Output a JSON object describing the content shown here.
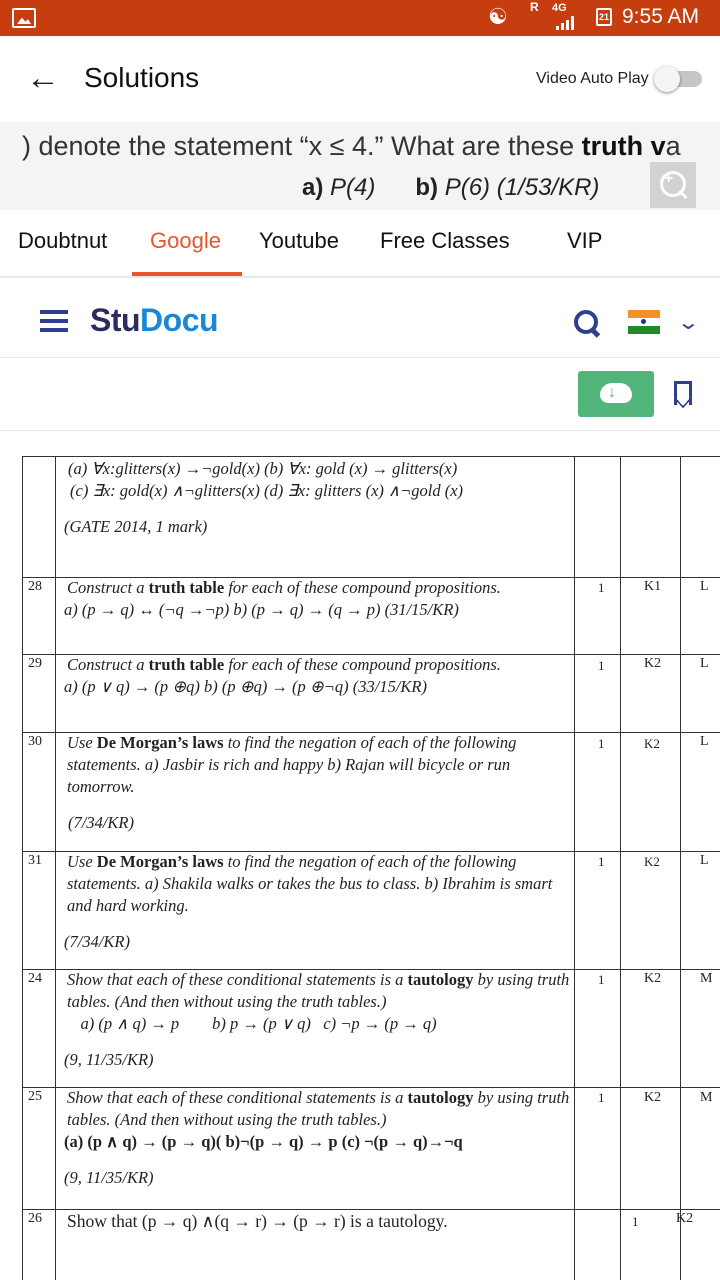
{
  "status_bar": {
    "carrier_flag": "R",
    "network": "4G",
    "calendar_day": "21",
    "time": "9:55 AM",
    "icons": [
      "gallery-icon",
      "wifi-icon",
      "signal-icon",
      "calendar-icon"
    ]
  },
  "header": {
    "title": "Solutions",
    "autoplay_label": "Video Auto Play",
    "autoplay_on": false
  },
  "question": {
    "line1_prefix": ") denote the statement “x ≤ 4.” What are these ",
    "line1_bold": "truth v",
    "line1_suffix": "a",
    "part_a_label": "a)",
    "part_a_text": " P(4)",
    "part_b_label": "b)",
    "part_b_text": " P(6)  (1/53/KR)"
  },
  "tabs": {
    "items": [
      "Doubtnut",
      "Google",
      "Youtube",
      "Free Classes",
      "VIP"
    ],
    "active_index": 1
  },
  "studocu": {
    "logo_part1": "Stu",
    "logo_part2": "Docu",
    "brand_color": "#1a88d8",
    "download_color": "#52b57a"
  },
  "document": {
    "top_block": {
      "line1": "(a) ∀x:glitters(x) →¬gold(x)   (b) ∀x: gold (x) → glitters(x)",
      "line2": "(c) ∃x: gold(x) ∧¬glitters(x)   (d) ∃x: glitters (x) ∧¬gold (x)",
      "ref": "(GATE 2014, 1 mark)"
    },
    "rows": [
      {
        "no": "28",
        "pre": "Construct a ",
        "bold": "truth table",
        "post": " for each of these compound propositions.",
        "line2": "a) (p → q) ↔ (¬q →¬p)   b) (p → q) → (q → p)            (31/15/KR)",
        "ref": "",
        "marks": "1",
        "level": "K1",
        "cat": "L"
      },
      {
        "no": "29",
        "pre": "Construct a ",
        "bold": "truth table",
        "post": " for each of these compound propositions.",
        "line2": "a) (p ∨ q) → (p ⊕q)   b) (p ⊕q) → (p ⊕¬q) (33/15/KR)",
        "ref": "",
        "marks": "1",
        "level": "K2",
        "cat": "L"
      },
      {
        "no": "30",
        "pre": "Use ",
        "bold": "De Morgan’s laws",
        "post": " to find the negation of each of the following statements.   a) Jasbir is rich and happy  b) Rajan will bicycle or run tomorrow.",
        "line2": "",
        "ref": "(7/34/KR)",
        "marks": "1",
        "level": "K2",
        "cat": "L"
      },
      {
        "no": "31",
        "pre": "Use ",
        "bold": "De Morgan’s laws",
        "post": " to find the negation of each of the following statements.   a)  Shakila walks or takes the bus to class.   b) Ibrahim is smart and hard working.",
        "line2": "",
        "ref": "(7/34/KR)",
        "marks": "1",
        "level": "K2",
        "cat": "L"
      },
      {
        "no": "24",
        "pre": "Show that each of these conditional statements is a ",
        "bold": "tautology",
        "post": " by using truth tables. (And then without using the truth   tables.)",
        "line2": "    a) (p ∧ q) → p        b) p → (p ∨ q)   c) ¬p → (p → q)",
        "ref": "(9, 11/35/KR)",
        "marks": "1",
        "level": "K2",
        "cat": "M"
      },
      {
        "no": "25",
        "pre": "Show that each of these conditional statements is a ",
        "bold": "tautology",
        "post": " by using truth tables. (And then without using the truth   tables.)",
        "line2": "(a) (p ∧ q) → (p → q)( b)¬(p → q) → p   (c) ¬(p → q)→¬q",
        "ref": "(9, 11/35/KR)",
        "marks": "1",
        "level": "K2",
        "cat": "M"
      },
      {
        "no": "26",
        "pre": "Show that ",
        "bold": "",
        "post": "(p → q) ∧(q → r) → (p → r) is a tautology.",
        "line2": "",
        "ref": "",
        "marks": "1",
        "level": "K2",
        "cat": ""
      }
    ]
  }
}
